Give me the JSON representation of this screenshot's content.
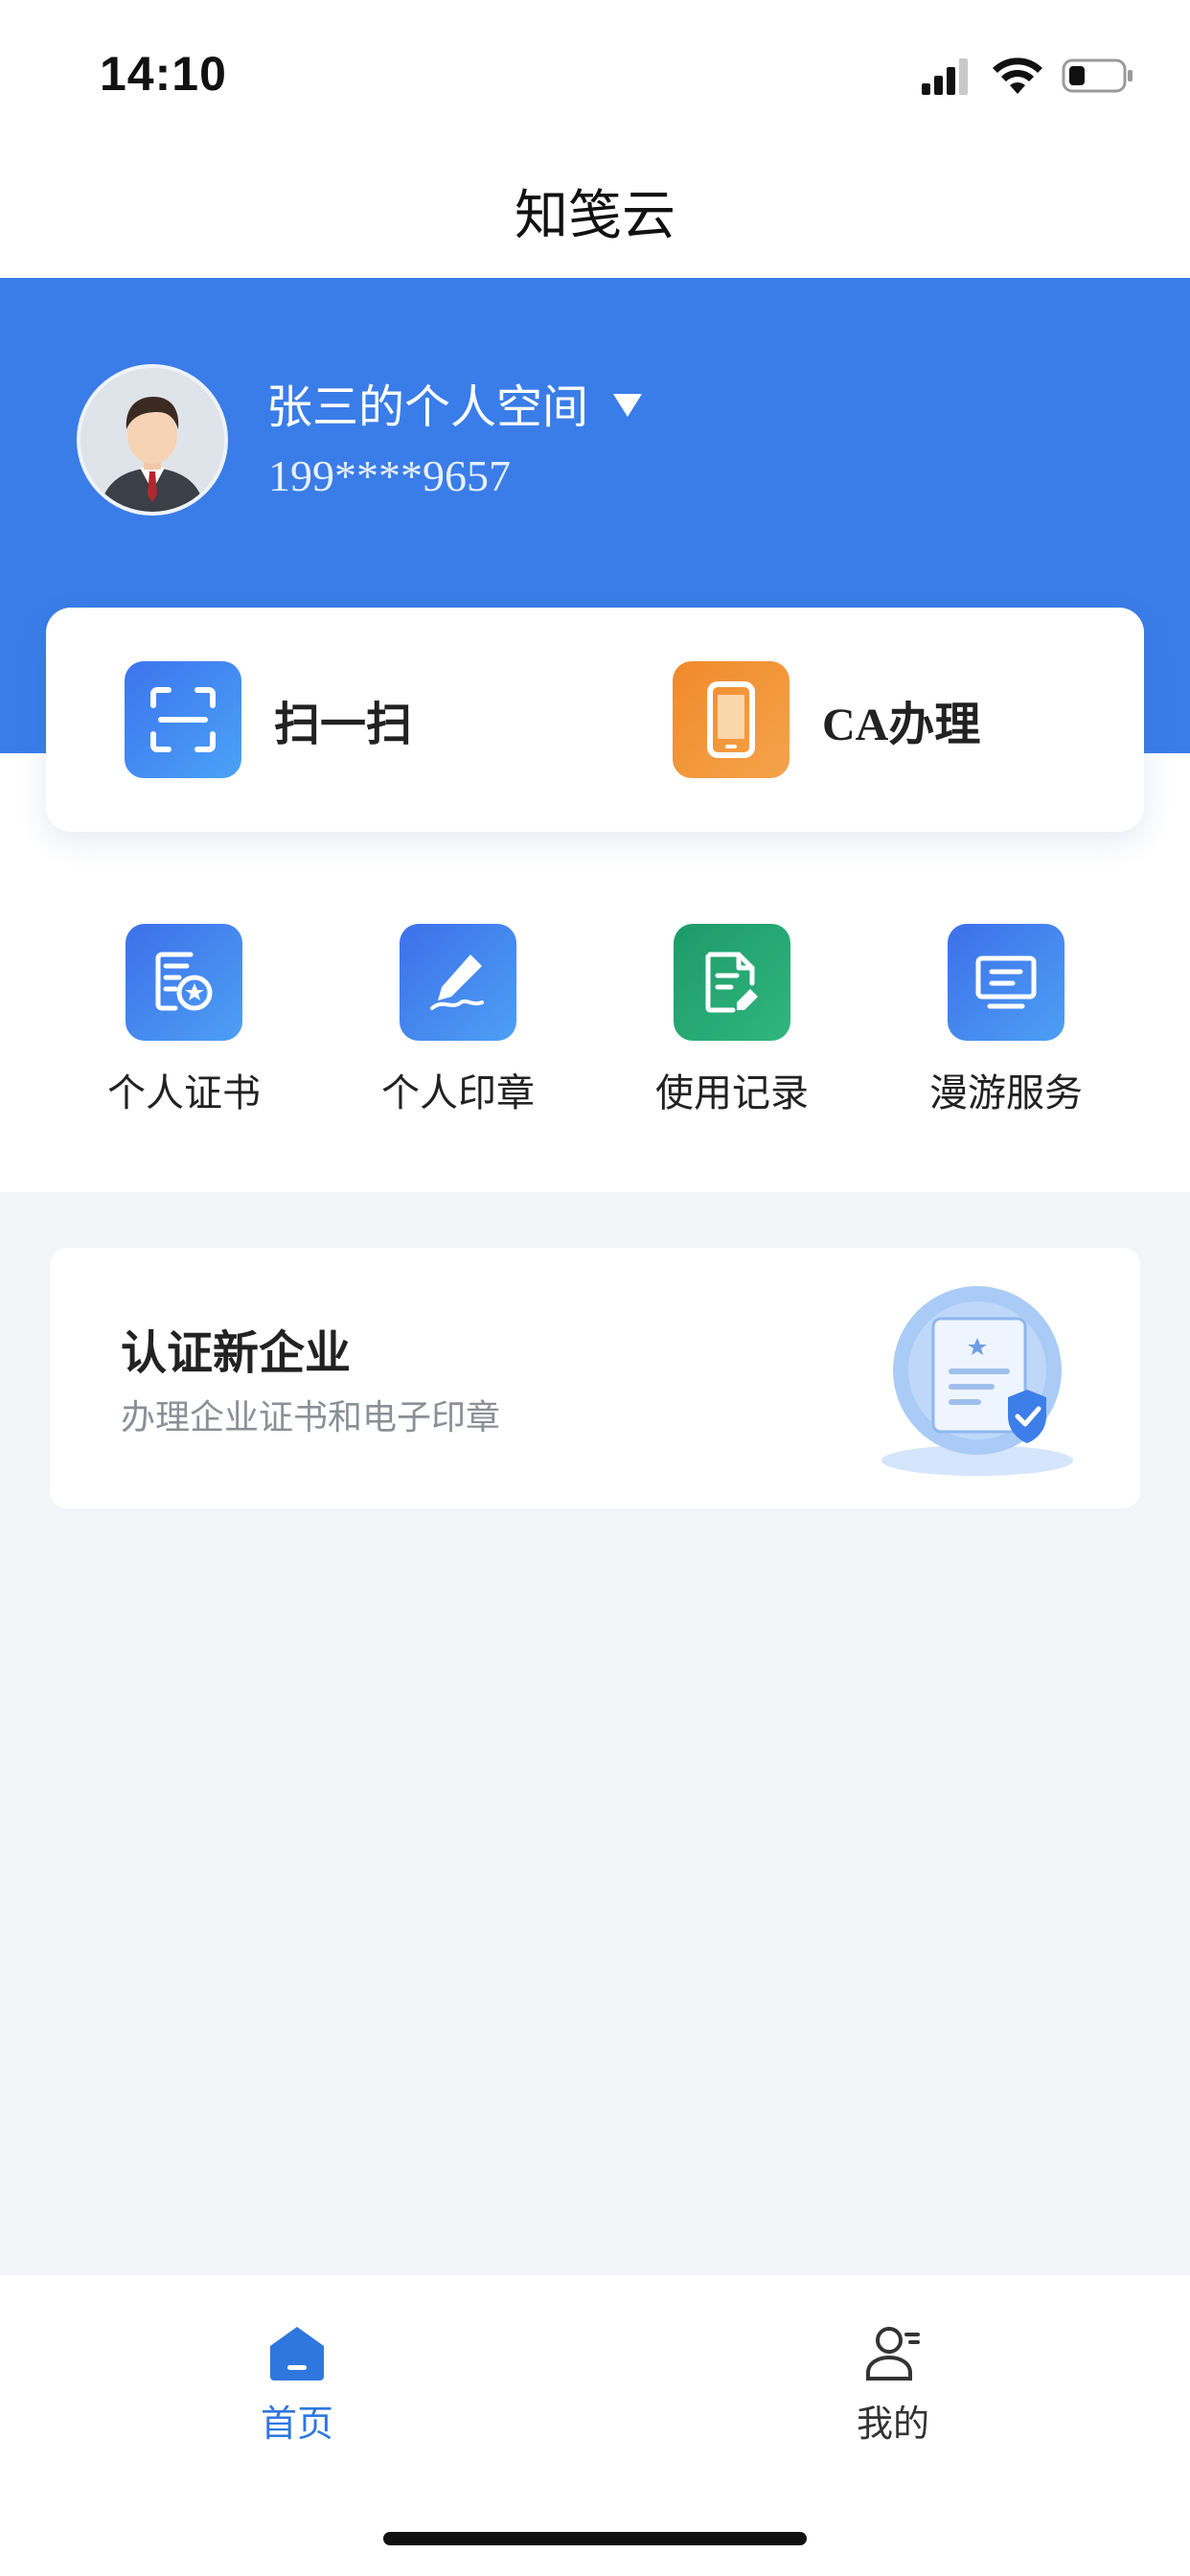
{
  "status_bar": {
    "time": "14:10",
    "icons": [
      "cellular-signal-icon",
      "wifi-icon",
      "battery-icon"
    ]
  },
  "nav": {
    "title": "知笺云"
  },
  "profile": {
    "space_name": "张三的个人空间",
    "phone": "199****9657"
  },
  "quick_actions": [
    {
      "label": "扫一扫",
      "icon": "scan-icon"
    },
    {
      "label": "CA办理",
      "icon": "mobile-phone-icon"
    }
  ],
  "features": [
    {
      "label": "个人证书",
      "icon": "certificate-icon"
    },
    {
      "label": "个人印章",
      "icon": "signature-pen-icon"
    },
    {
      "label": "使用记录",
      "icon": "document-edit-icon"
    },
    {
      "label": "漫游服务",
      "icon": "monitor-icon"
    }
  ],
  "enterprise_card": {
    "title": "认证新企业",
    "subtitle": "办理企业证书和电子印章"
  },
  "tab_bar": {
    "tabs": [
      {
        "label": "首页",
        "icon": "home-icon",
        "active": true
      },
      {
        "label": "我的",
        "icon": "user-profile-icon",
        "active": false
      }
    ]
  },
  "colors": {
    "brand_blue": "#3a7de8",
    "active_tab": "#2f77de",
    "orange": "#f08a2c",
    "green": "#1e9a6a"
  }
}
